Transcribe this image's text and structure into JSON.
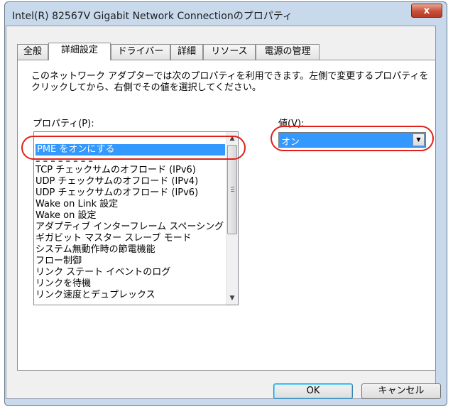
{
  "window": {
    "title": "Intel(R) 82567V Gigabit Network Connectionのプロパティ",
    "close_label": "x"
  },
  "tabs": [
    "全般",
    "詳細設定",
    "ドライバー",
    "詳細",
    "リソース",
    "電源の管理"
  ],
  "active_tab": "詳細設定",
  "description": "このネットワーク アダプターでは次のプロパティを利用できます。左側で変更するプロパティを\nクリックしてから、右側でその値を選択してください。",
  "property_label": "プロパティ(P):",
  "value_label": "値(V):",
  "properties": {
    "items": [
      "PME をオンにする",
      "TCP チェックサムのオフロード (IPv6)",
      "UDP チェックサムのオフロード (IPv4)",
      "UDP チェックサムのオフロード (IPv6)",
      "Wake on Link 設定",
      "Wake on 設定",
      "アダプティブ インターフレーム スペーシング",
      "ギガビット マスター スレーブ モード",
      "システム無動作時の節電機能",
      "フロー制御",
      "リンク ステート イベントのログ",
      "リンクを待機",
      "リンク速度とデュプレックス"
    ],
    "selected": "PME をオンにする"
  },
  "value": {
    "selected": "オン"
  },
  "buttons": {
    "ok": "OK",
    "cancel": "キャンセル"
  },
  "colors": {
    "selection": "#3399ff",
    "highlight_ring": "#e0201a",
    "titlebar": "#c9d9ec",
    "close": "#c7503a"
  }
}
